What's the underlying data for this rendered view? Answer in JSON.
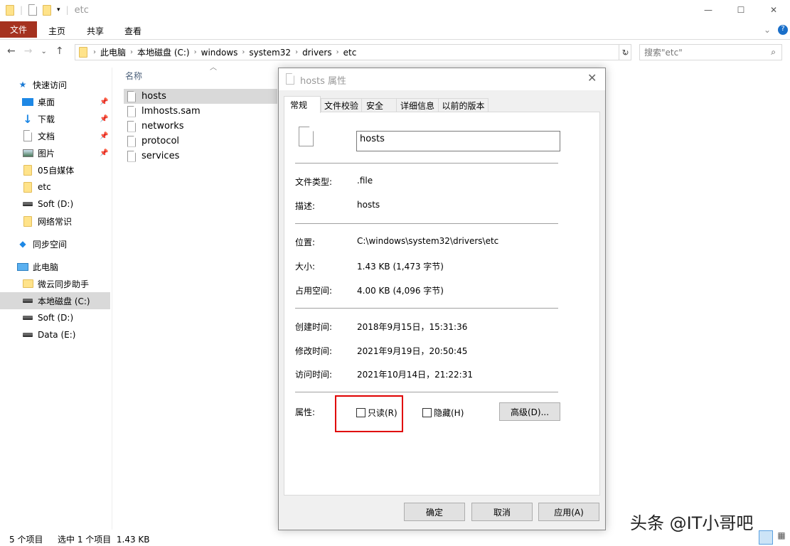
{
  "window": {
    "title": "etc",
    "minimize": "—",
    "maximize": "☐",
    "close": "✕"
  },
  "ribbon": {
    "tabs": [
      "文件",
      "主页",
      "共享",
      "查看"
    ],
    "file_tab_color": "#a5321f"
  },
  "address": {
    "crumbs": [
      "此电脑",
      "本地磁盘 (C:)",
      "windows",
      "system32",
      "drivers",
      "etc"
    ],
    "search_placeholder": "搜索\"etc\""
  },
  "sidebar": {
    "quick_access": "快速访问",
    "items": [
      {
        "label": "桌面",
        "icon": "desktop-icon",
        "pinned": true
      },
      {
        "label": "下载",
        "icon": "download-icon",
        "pinned": true
      },
      {
        "label": "文档",
        "icon": "document-icon",
        "pinned": true
      },
      {
        "label": "图片",
        "icon": "pictures-icon",
        "pinned": true
      },
      {
        "label": "05自媒体",
        "icon": "folder-icon"
      },
      {
        "label": "etc",
        "icon": "folder-icon"
      },
      {
        "label": "Soft (D:)",
        "icon": "drive-icon"
      },
      {
        "label": "网络常识",
        "icon": "folder-icon"
      }
    ],
    "sync": "同步空间",
    "this_pc": "此电脑",
    "pc_items": [
      {
        "label": "微云同步助手",
        "icon": "cloud-folder-icon"
      },
      {
        "label": "本地磁盘 (C:)",
        "icon": "windows-drive-icon",
        "selected": true
      },
      {
        "label": "Soft (D:)",
        "icon": "drive-icon"
      },
      {
        "label": "Data (E:)",
        "icon": "drive-icon"
      }
    ]
  },
  "files": {
    "column": "名称",
    "items": [
      "hosts",
      "lmhosts.sam",
      "networks",
      "protocol",
      "services"
    ],
    "selected": "hosts"
  },
  "status": {
    "count": "5 个项目",
    "selection": "选中 1 个项目  1.43 KB"
  },
  "dialog": {
    "title": "hosts 属性",
    "tabs": [
      "常规",
      "文件校验",
      "安全",
      "详细信息",
      "以前的版本"
    ],
    "active_tab": "常规",
    "name": "hosts",
    "rows": {
      "type": {
        "label": "文件类型:",
        "value": ".file"
      },
      "desc": {
        "label": "描述:",
        "value": "hosts"
      },
      "location": {
        "label": "位置:",
        "value": "C:\\windows\\system32\\drivers\\etc"
      },
      "size": {
        "label": "大小:",
        "value": "1.43 KB (1,473 字节)"
      },
      "disk": {
        "label": "占用空间:",
        "value": "4.00 KB (4,096 字节)"
      },
      "created": {
        "label": "创建时间:",
        "value": "2018年9月15日，15:31:36"
      },
      "modified": {
        "label": "修改时间:",
        "value": "2021年9月19日，20:50:45"
      },
      "accessed": {
        "label": "访问时间:",
        "value": "2021年10月14日，21:22:31"
      }
    },
    "attributes": {
      "label": "属性:",
      "readonly": "只读(R)",
      "readonly_checked": false,
      "hidden": "隐藏(H)",
      "hidden_checked": false,
      "advanced": "高级(D)..."
    },
    "highlight_color": "#e00000",
    "buttons": {
      "ok": "确定",
      "cancel": "取消",
      "apply": "应用(A)"
    }
  },
  "watermark": "头条 @IT小哥吧"
}
